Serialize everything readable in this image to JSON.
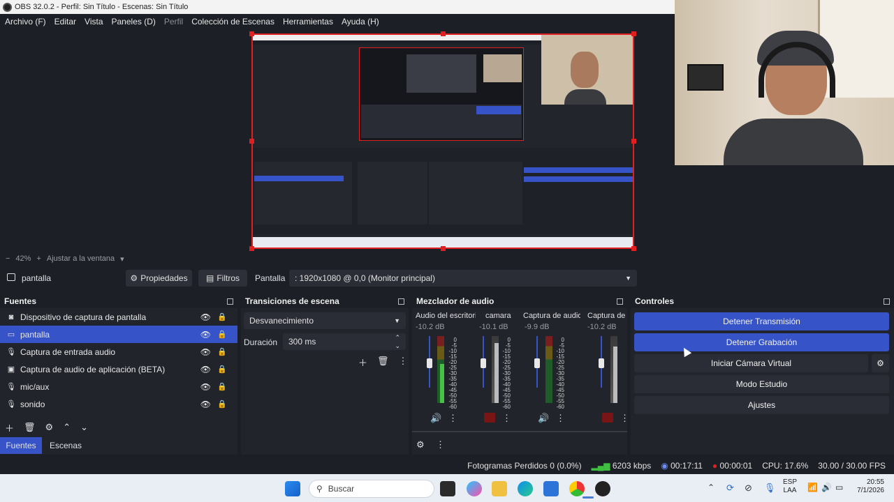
{
  "window": {
    "title": "OBS 32.0.2 - Perfil: Sin Título - Escenas: Sin Título"
  },
  "menu": [
    "Archivo (F)",
    "Editar",
    "Vista",
    "Paneles (D)",
    "Perfil",
    "Colección de Escenas",
    "Herramientas",
    "Ayuda (H)"
  ],
  "zoom": {
    "minus": "−",
    "level": "42%",
    "plus": "+",
    "fit_label": "Ajustar a la ventana"
  },
  "source_bar": {
    "source_name": "pantalla",
    "properties_label": "Propiedades",
    "filters_label": "Filtros",
    "display_label": "Pantalla",
    "display_value": ": 1920x1080 @ 0,0 (Monitor principal)"
  },
  "sources": {
    "title": "Fuentes",
    "items": [
      {
        "label": "Dispositivo de captura de pantalla",
        "icon": "camera-icon"
      },
      {
        "label": "pantalla",
        "icon": "monitor-icon",
        "selected": true
      },
      {
        "label": "Captura de entrada audio",
        "icon": "mic-icon"
      },
      {
        "label": "Captura de audio de aplicación (BETA)",
        "icon": "app-audio-icon"
      },
      {
        "label": "mic/aux",
        "icon": "mic-icon"
      },
      {
        "label": "sonido",
        "icon": "mic-icon"
      }
    ],
    "tabs": [
      "Fuentes",
      "Escenas"
    ]
  },
  "transitions": {
    "title": "Transiciones de escena",
    "selected": "Desvanecimiento",
    "duration_label": "Duración",
    "duration_value": "300 ms"
  },
  "mixer": {
    "title": "Mezclador de audio",
    "channels": [
      {
        "name": "Audio del escritorio",
        "db": "-10.2 dB"
      },
      {
        "name": "camara",
        "db": "-10.1 dB"
      },
      {
        "name": "Captura de audio d",
        "db": "-9.9 dB"
      },
      {
        "name": "Captura de e",
        "db": "-10.2 dB"
      }
    ],
    "scale": [
      "0",
      "-5",
      "-10",
      "-15",
      "-20",
      "-25",
      "-30",
      "-35",
      "-40",
      "-45",
      "-50",
      "-55",
      "-60"
    ]
  },
  "controls": {
    "title": "Controles",
    "stop_stream": "Detener Transmisión",
    "stop_record": "Detener Grabación",
    "virtual_cam": "Iniciar Cámara Virtual",
    "studio_mode": "Modo Estudio",
    "settings": "Ajustes"
  },
  "status": {
    "dropped": "Fotogramas Perdidos 0 (0.0%)",
    "bitrate": "6203 kbps",
    "stream_time": "00:17:11",
    "rec_time": "00:00:01",
    "cpu": "CPU: 17.6%",
    "fps": "30.00 / 30.00 FPS"
  },
  "taskbar": {
    "search_placeholder": "Buscar",
    "lang_top": "ESP",
    "lang_bottom": "LAA",
    "time": "20:55",
    "date": "7/1/2026"
  },
  "colors": {
    "accent": "#3654c8",
    "selection_red": "#e02020",
    "record": "#e02020"
  }
}
